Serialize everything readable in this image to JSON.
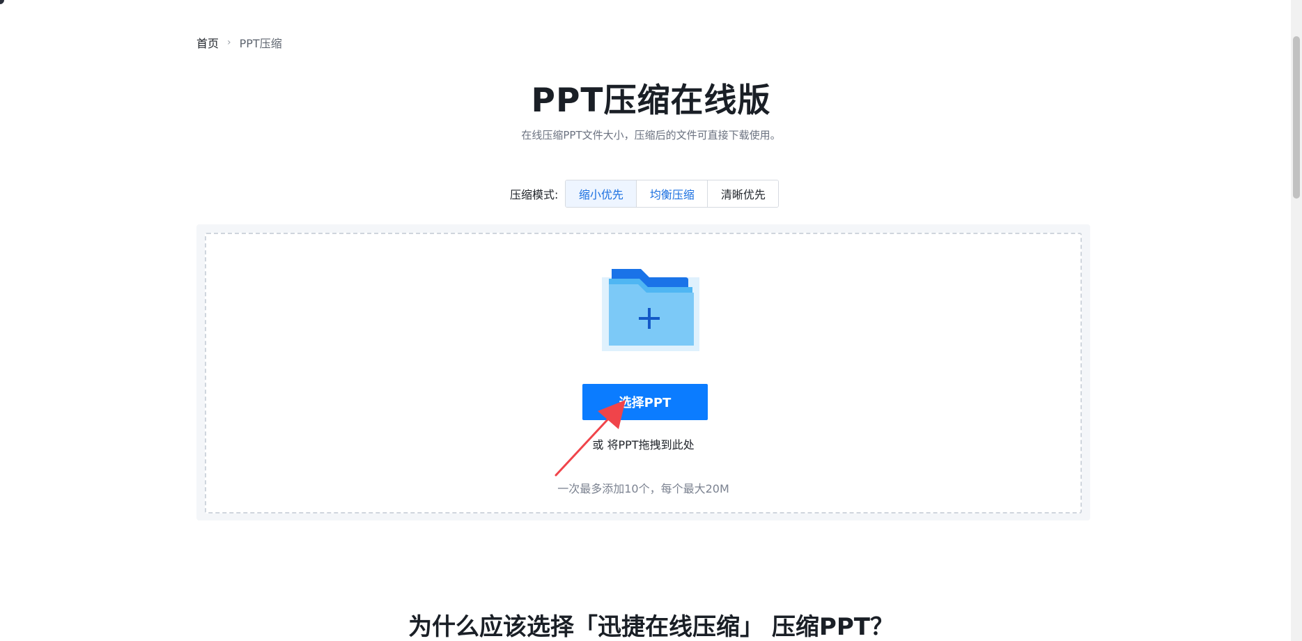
{
  "breadcrumb": {
    "home": "首页",
    "separator": "›",
    "current": "PPT压缩"
  },
  "header": {
    "title": "PPT压缩在线版",
    "subtitle": "在线压缩PPT文件大小，压缩后的文件可直接下载使用。"
  },
  "compress_mode": {
    "label": "压缩模式:",
    "options": [
      "缩小优先",
      "均衡压缩",
      "清晰优先"
    ],
    "selected": "缩小优先"
  },
  "upload": {
    "icon": "folder-add-icon",
    "button_label": "选择PPT",
    "drag_hint": "或 将PPT拖拽到此处",
    "limit_hint": "一次最多添加10个，每个最大20M"
  },
  "section": {
    "heading": "为什么应该选择「迅捷在线压缩」 压缩PPT？"
  },
  "colors": {
    "accent": "#0b7cff",
    "annotation": "#f0444a",
    "folder_dark": "#1a73e8",
    "folder_light": "#7cc9f7"
  }
}
